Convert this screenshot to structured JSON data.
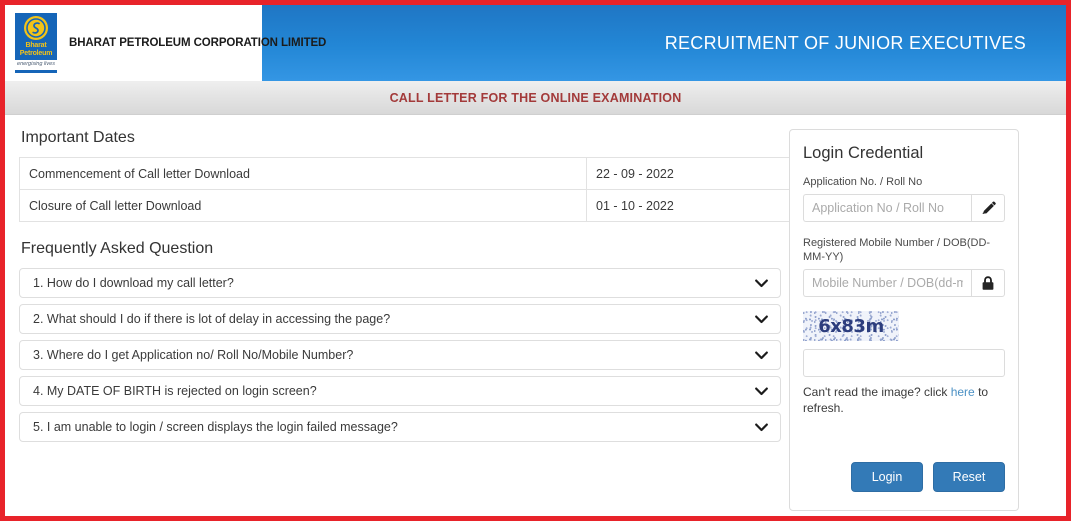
{
  "header": {
    "company_name": "BHARAT PETROLEUM CORPORATION LIMITED",
    "logo_word_line1": "Bharat",
    "logo_word_line2": "Petroleum",
    "logo_tagline": "energising lives",
    "title": "RECRUITMENT OF JUNIOR EXECUTIVES",
    "banner": "CALL LETTER FOR THE ONLINE EXAMINATION",
    "accent_blue": "#2387d6",
    "banner_text_color": "#a33a3a",
    "frame_border_color": "#e8232a"
  },
  "important_dates": {
    "section_title": "Important Dates",
    "rows": [
      {
        "label": "Commencement of Call letter Download",
        "value": "22 - 09 - 2022"
      },
      {
        "label": "Closure of Call letter Download",
        "value": "01 - 10 - 2022"
      }
    ]
  },
  "faq": {
    "section_title": "Frequently Asked Question",
    "expand_icon": "⌄",
    "items": [
      {
        "text": "1. How do I download my call letter?"
      },
      {
        "text": "2. What should I do if there is lot of delay in accessing the page?"
      },
      {
        "text": "3. Where do I get Application no/ Roll No/Mobile Number?"
      },
      {
        "text": "4. My DATE OF BIRTH is rejected on login screen?"
      },
      {
        "text": "5. I am unable to login / screen displays the login failed message?"
      }
    ]
  },
  "login": {
    "title": "Login Credential",
    "application_label": "Application No. / Roll No",
    "application_placeholder": "Application No / Roll No",
    "application_value": "",
    "mobile_label": "Registered Mobile Number / DOB(DD-MM-YY)",
    "mobile_placeholder": "Mobile Number / DOB(dd-m",
    "mobile_value": "",
    "captcha_text": "6x83m",
    "captcha_input_value": "",
    "captcha_input_placeholder": "",
    "refresh_prefix": "Can't read the image? click ",
    "refresh_link": "here",
    "refresh_suffix": " to refresh.",
    "login_button": "Login",
    "reset_button": "Reset",
    "button_color": "#337ab7",
    "link_color": "#4a90c4"
  }
}
